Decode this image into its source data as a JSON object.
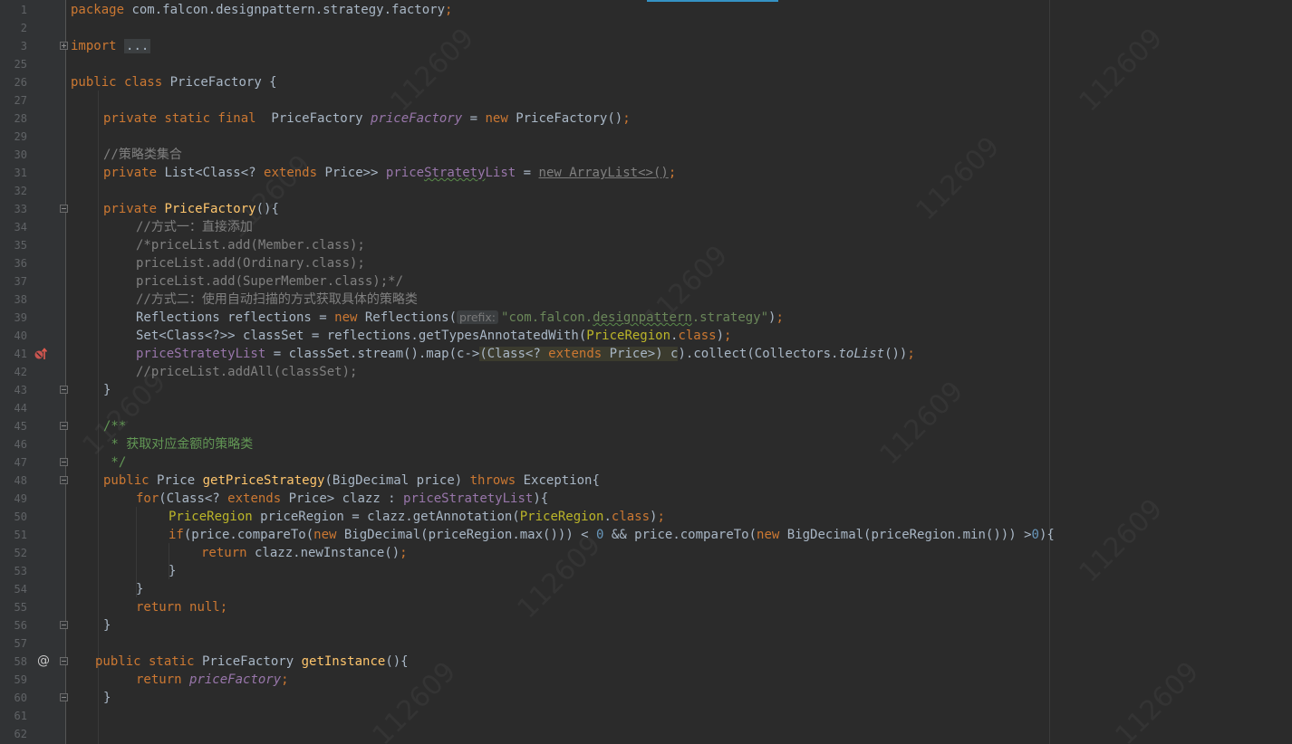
{
  "editor": {
    "file_package": "com.falcon.designpattern.strategy.factory",
    "watermark_text": "112609",
    "colors": {
      "background": "#2b2b2b",
      "gutter": "#313335",
      "keyword": "#cc7832",
      "string": "#6a8759",
      "comment": "#808080",
      "field": "#9876aa",
      "method": "#ffc66d",
      "annotation": "#bbb529"
    }
  },
  "gutter": {
    "line_numbers": [
      "1",
      "2",
      "3",
      "25",
      "26",
      "27",
      "28",
      "29",
      "30",
      "31",
      "32",
      "33",
      "34",
      "35",
      "36",
      "37",
      "38",
      "39",
      "40",
      "41",
      "42",
      "43",
      "44",
      "45",
      "46",
      "47",
      "48",
      "49",
      "50",
      "51",
      "52",
      "53",
      "54",
      "55",
      "56",
      "57",
      "58",
      "59",
      "60",
      "61",
      "62"
    ],
    "icons": {
      "line41": "breakpoint-override-icon",
      "line58": "annotation-at-icon"
    }
  },
  "code": {
    "l1": {
      "kw": "package",
      "rest": " com.falcon.designpattern.strategy.factory",
      "semi": ";"
    },
    "l3": {
      "kw": "import",
      "folded": "..."
    },
    "l26": {
      "kw1": "public",
      "kw2": "class",
      "name": " PriceFactory {"
    },
    "l28": {
      "kw": "private static final",
      "type": "  PriceFactory ",
      "field": "priceFactory",
      "eq": " = ",
      "new": "new",
      "ctor": " PriceFactory()",
      "semi": ";"
    },
    "l30": {
      "comment": "//策略类集合"
    },
    "l31": {
      "kw": "private",
      "t1": " List<Class<? ",
      "ext": "extends",
      "t2": " Price>> ",
      "field_a": "price",
      "field_b": "Stratety",
      "field_c": "List",
      "eq": " = ",
      "newexpr": "new ArrayList<>()",
      "semi": ";"
    },
    "l33": {
      "kw": "private",
      "sp": " ",
      "method": "PriceFactory",
      "rest": "(){"
    },
    "l34": {
      "comment": "//方式一：直接添加"
    },
    "l35": {
      "comment": "/*priceList.add(Member.class);"
    },
    "l36": {
      "comment": "priceList.add(Ordinary.class);"
    },
    "l37": {
      "comment": "priceList.add(SuperMember.class);*/"
    },
    "l38": {
      "comment": "//方式二：使用自动扫描的方式获取具体的策略类"
    },
    "l39": {
      "t1": "Reflections reflections = ",
      "new": "new",
      "t2": " Reflections(",
      "hint": "prefix:",
      "s1": "\"com.falcon.",
      "s2": "designpattern",
      "s3": ".strategy\"",
      "close": ")",
      "semi": ";"
    },
    "l40": {
      "t1": "Set<Class<?>> classSet = reflections.getTypesAnnotatedWith(",
      "ann": "PriceRegion",
      "dot": ".",
      "kwclass": "class",
      "close": ")",
      "semi": ";"
    },
    "l41": {
      "field": "priceStratetyList",
      "t1": " = classSet.stream().map(c->",
      "c1": "(Class<? ",
      "ext": "extends",
      "c2": " Price>) ",
      "c3": "c",
      "t2": ").collect(Collectors.",
      "tolist": "toList",
      "t3": "())",
      "semi": ";"
    },
    "l42": {
      "comment": "//priceList.addAll(classSet);"
    },
    "l43": {
      "text": "}"
    },
    "l45": {
      "doc": "/**"
    },
    "l46": {
      "doc": " * 获取对应金额的策略类"
    },
    "l47": {
      "doc": " */"
    },
    "l48": {
      "kw": "public",
      "t1": " Price ",
      "method": "getPriceStrategy",
      "t2": "(BigDecimal price) ",
      "throws": "throws",
      "t3": " Exception{"
    },
    "l49": {
      "kwfor": "for",
      "t1": "(Class<? ",
      "ext": "extends",
      "t2": " Price> clazz : ",
      "field": "priceStratetyList",
      "t3": "){"
    },
    "l50": {
      "ann1": "PriceRegion",
      "t1": " priceRegion = clazz.getAnnotation(",
      "ann2": "PriceRegion",
      "dot": ".",
      "kwclass": "class",
      "close": ")",
      "semi": ";"
    },
    "l51": {
      "kwif": "if",
      "t1": "(price.compareTo(",
      "new1": "new",
      "t2": " BigDecimal(priceRegion.max())) < ",
      "n0": "0",
      "t3": " && price.compareTo(",
      "new2": "new",
      "t4": " BigDecimal(priceRegion.min())) >",
      "n1": "0",
      "t5": "){"
    },
    "l52": {
      "kw": "return",
      "t1": " clazz.newInstance()",
      "semi": ";"
    },
    "l53": {
      "text": "}"
    },
    "l54": {
      "text": "}"
    },
    "l55": {
      "kw": "return",
      "sp": " ",
      "nullkw": "null",
      "semi": ";"
    },
    "l56": {
      "text": "}"
    },
    "l58": {
      "kw": "public static",
      "t1": " PriceFactory ",
      "method": "getInstance",
      "t2": "(){"
    },
    "l59": {
      "kw": "return",
      "sp": " ",
      "field": "priceFactory",
      "semi": ";"
    },
    "l60": {
      "text": "}"
    }
  }
}
